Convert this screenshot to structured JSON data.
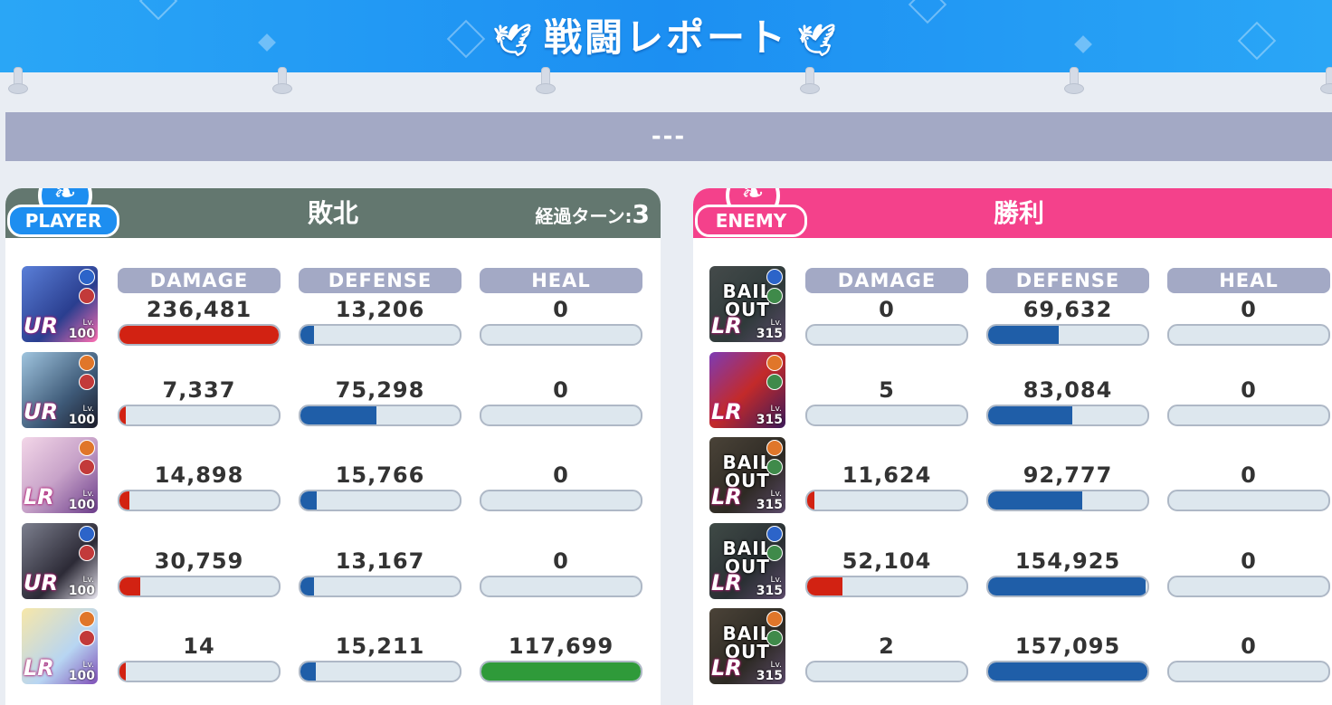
{
  "title": "戦闘レポート",
  "subtitle": "---",
  "columns": {
    "damage": "DAMAGE",
    "defense": "DEFENSE",
    "heal": "HEAL"
  },
  "player": {
    "badge": "PLAYER",
    "result": "敗北",
    "turns_label": "経過ターン:",
    "turns": "3",
    "color": "#63776f",
    "units": [
      {
        "rarity": "UR",
        "level": "100",
        "bailed_out": false,
        "damage": "236,481",
        "defense": "13,206",
        "heal": "0",
        "damage_pct": 1.0,
        "defense_pct": 0.084,
        "heal_pct": 0
      },
      {
        "rarity": "UR",
        "level": "100",
        "bailed_out": false,
        "damage": "7,337",
        "defense": "75,298",
        "heal": "0",
        "damage_pct": 0.031,
        "defense_pct": 0.48,
        "heal_pct": 0
      },
      {
        "rarity": "LR",
        "level": "100",
        "bailed_out": false,
        "damage": "14,898",
        "defense": "15,766",
        "heal": "0",
        "damage_pct": 0.063,
        "defense_pct": 0.1,
        "heal_pct": 0
      },
      {
        "rarity": "UR",
        "level": "100",
        "bailed_out": false,
        "damage": "30,759",
        "defense": "13,167",
        "heal": "0",
        "damage_pct": 0.13,
        "defense_pct": 0.084,
        "heal_pct": 0
      },
      {
        "rarity": "LR",
        "level": "100",
        "bailed_out": false,
        "damage": "14",
        "defense": "15,211",
        "heal": "117,699",
        "damage_pct": 0.0,
        "defense_pct": 0.097,
        "heal_pct": 1.0
      }
    ]
  },
  "enemy": {
    "badge": "ENEMY",
    "result": "勝利",
    "color": "#f4418b",
    "units": [
      {
        "rarity": "LR",
        "level": "315",
        "bailed_out": true,
        "bail_text": "BAIL OUT",
        "damage": "0",
        "defense": "69,632",
        "heal": "0",
        "damage_pct": 0,
        "defense_pct": 0.443,
        "heal_pct": 0
      },
      {
        "rarity": "LR",
        "level": "315",
        "bailed_out": false,
        "damage": "5",
        "defense": "83,084",
        "heal": "0",
        "damage_pct": 0,
        "defense_pct": 0.529,
        "heal_pct": 0
      },
      {
        "rarity": "LR",
        "level": "315",
        "bailed_out": true,
        "bail_text": "BAIL OUT",
        "damage": "11,624",
        "defense": "92,777",
        "heal": "0",
        "damage_pct": 0.045,
        "defense_pct": 0.59,
        "heal_pct": 0
      },
      {
        "rarity": "LR",
        "level": "315",
        "bailed_out": true,
        "bail_text": "BAIL OUT",
        "damage": "52,104",
        "defense": "154,925",
        "heal": "0",
        "damage_pct": 0.22,
        "defense_pct": 0.986,
        "heal_pct": 0
      },
      {
        "rarity": "LR",
        "level": "315",
        "bailed_out": true,
        "bail_text": "BAIL OUT",
        "damage": "2",
        "defense": "157,095",
        "heal": "0",
        "damage_pct": 0,
        "defense_pct": 1.0,
        "heal_pct": 0
      }
    ]
  },
  "level_prefix": "Lv.",
  "colors": {
    "damage": "#d22212",
    "defense": "#1f5ea8",
    "heal": "#2f9a3a",
    "header": "#a3a9c5"
  }
}
